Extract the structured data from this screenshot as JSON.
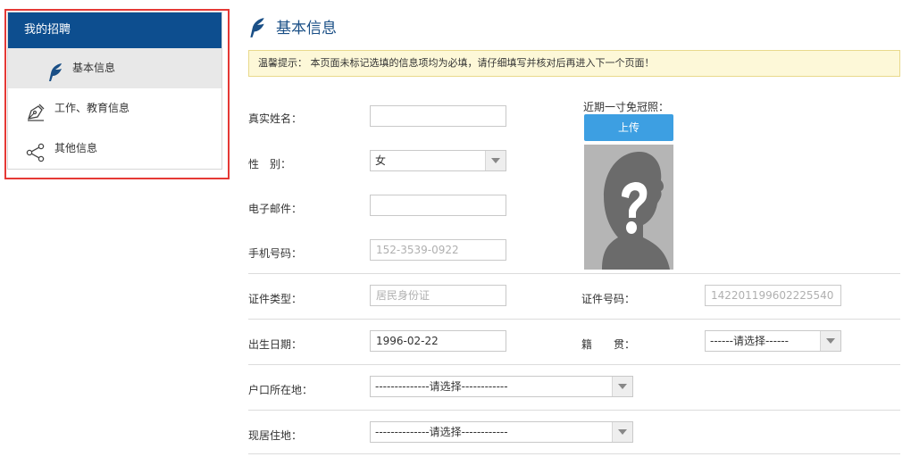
{
  "sidebar": {
    "header": "我的招聘",
    "items": [
      {
        "label": "基本信息",
        "icon": "feather-icon",
        "active": true
      },
      {
        "label": "工作、教育信息",
        "icon": "pen-nib-icon",
        "active": false
      },
      {
        "label": "其他信息",
        "icon": "share-icon",
        "active": false
      }
    ]
  },
  "page": {
    "title": "基本信息",
    "notice": "温馨提示：  本页面未标记选填的信息项均为必填，请仔细填写并核对后再进入下一个页面！"
  },
  "form": {
    "name_label": "真实姓名：",
    "name_value": "",
    "gender_label": "性　别：",
    "gender_value": "女",
    "email_label": "电子邮件：",
    "email_value": "",
    "phone_label": "手机号码：",
    "phone_placeholder": "152-3539-0922",
    "photo_label": "近期一寸免冠照：",
    "upload_label": "上传",
    "id_type_label": "证件类型：",
    "id_type_placeholder": "居民身份证",
    "id_number_label": "证件号码：",
    "id_number_placeholder": "142201199602225540",
    "birth_label": "出生日期：",
    "birth_value": "1996-02-22",
    "native_label": "籍　　贯：",
    "native_value": "------请选择------",
    "hukou_label": "户口所在地：",
    "hukou_value": "--------------请选择------------",
    "residence_label": "现居住地：",
    "residence_value": "--------------请选择------------"
  },
  "colors": {
    "sidebar_header": "#0d4e8f",
    "accent": "#3d9fe2",
    "highlight_border": "#e53935",
    "notice_bg": "#fdf8d8"
  }
}
